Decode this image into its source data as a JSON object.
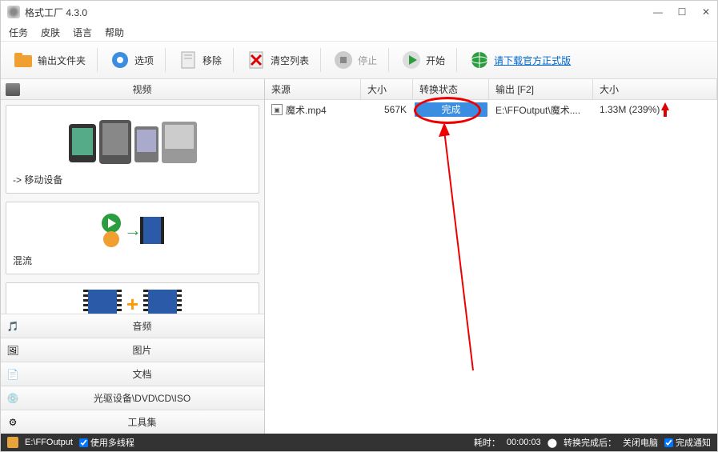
{
  "title": "格式工厂 4.3.0",
  "menu": {
    "task": "任务",
    "skin": "皮肤",
    "language": "语言",
    "help": "帮助"
  },
  "toolbar": {
    "output_folder": "输出文件夹",
    "options": "选项",
    "remove": "移除",
    "clear_list": "清空列表",
    "stop": "停止",
    "start": "开始",
    "download_link": "请下载官方正式版"
  },
  "sidebar": {
    "header": "视频",
    "card_mobile": "-> 移动设备",
    "card_mux": "混流",
    "categories": {
      "audio": "音频",
      "picture": "图片",
      "document": "文档",
      "drive": "光驱设备\\DVD\\CD\\ISO",
      "tools": "工具集"
    }
  },
  "table": {
    "headers": {
      "source": "来源",
      "size": "大小",
      "status": "转换状态",
      "output": "输出 [F2]",
      "out_size": "大小"
    },
    "rows": [
      {
        "source": "魔术.mp4",
        "size": "567K",
        "status": "完成",
        "output": "E:\\FFOutput\\魔术....",
        "out_size": "1.33M  (239%)"
      }
    ]
  },
  "statusbar": {
    "path": "E:\\FFOutput",
    "multithread": "使用多线程",
    "elapsed_label": "耗时：",
    "elapsed": "00:00:03",
    "after_label": "转换完成后：",
    "after_value": "关闭电脑",
    "notify": "完成通知"
  }
}
